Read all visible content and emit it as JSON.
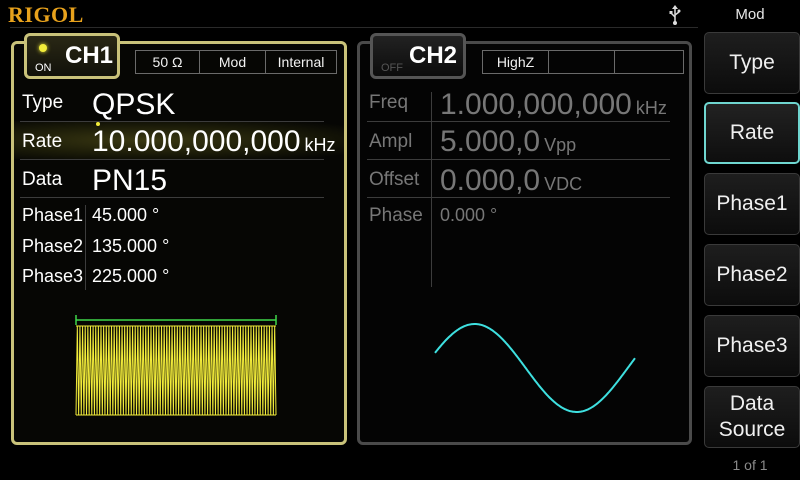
{
  "brand": "RIGOL",
  "menu": {
    "title": "Mod",
    "softkeys": [
      {
        "label": "Type"
      },
      {
        "label": "Rate"
      },
      {
        "label": "Phase1"
      },
      {
        "label": "Phase2"
      },
      {
        "label": "Phase3"
      },
      {
        "label": "Data Source"
      }
    ],
    "active": "Rate",
    "page": "1 of 1"
  },
  "ch1": {
    "name": "CH1",
    "state": "ON",
    "impedance": "50 Ω",
    "mode": "Mod",
    "source": "Internal",
    "params": {
      "type_label": "Type",
      "type_value": "QPSK",
      "rate_label": "Rate",
      "rate_value": "10.000,000,000",
      "rate_unit": "kHz",
      "data_label": "Data",
      "data_value": "PN15",
      "phase1_label": "Phase1",
      "phase1_value": "45.000 °",
      "phase2_label": "Phase2",
      "phase2_value": "135.000 °",
      "phase3_label": "Phase3",
      "phase3_value": "225.000 °"
    },
    "colors": {
      "accent": "#c9c27a",
      "waveform": "#f2ec3a",
      "marker": "#3fd64a"
    }
  },
  "ch2": {
    "name": "CH2",
    "state": "OFF",
    "impedance": "HighZ",
    "params": {
      "freq_label": "Freq",
      "freq_value": "1.000,000,000",
      "freq_unit": "kHz",
      "ampl_label": "Ampl",
      "ampl_value": "5.000,0",
      "ampl_unit": "Vpp",
      "offset_label": "Offset",
      "offset_value": "0.000,0",
      "offset_unit": "VDC",
      "phase_label": "Phase",
      "phase_value": "0.000 °"
    },
    "colors": {
      "waveform": "#3ee0e0"
    }
  }
}
